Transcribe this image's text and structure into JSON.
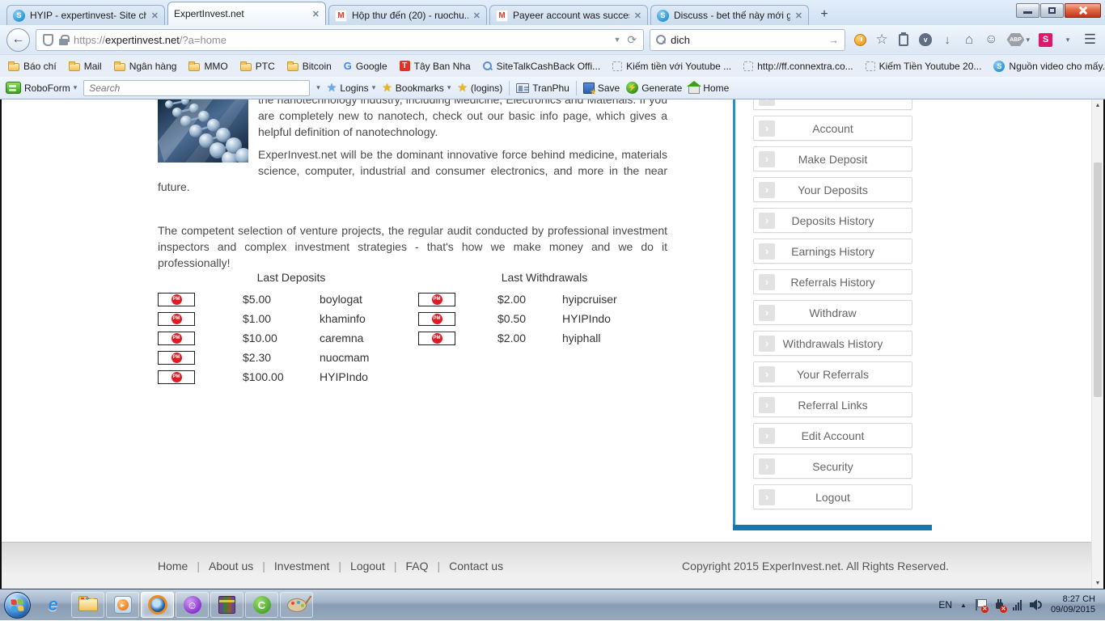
{
  "window": {
    "tabs": [
      {
        "title": "HYIP - expertinvest- Site ch...",
        "icon": "s-circle"
      },
      {
        "title": "ExpertInvest.net",
        "icon": "none"
      },
      {
        "title": "Hộp thư đến (20) - ruochu...",
        "icon": "gmail"
      },
      {
        "title": "Payeer account was succes...",
        "icon": "gmail"
      },
      {
        "title": "Discuss - bet thế này mới g...",
        "icon": "s-circle"
      }
    ]
  },
  "navbar": {
    "url_scheme": "https://",
    "url_domain": "expertinvest.net",
    "url_path": "/?a=home",
    "search_value": "dich"
  },
  "bookmarks_bar": {
    "items": [
      {
        "label": "Báo chí",
        "icon": "folder"
      },
      {
        "label": "Mail",
        "icon": "folder"
      },
      {
        "label": "Ngân hàng",
        "icon": "folder"
      },
      {
        "label": "MMO",
        "icon": "folder"
      },
      {
        "label": "PTC",
        "icon": "folder"
      },
      {
        "label": "Bitcoin",
        "icon": "folder"
      },
      {
        "label": "Google",
        "icon": "google"
      },
      {
        "label": "Tây Ban Nha",
        "icon": "red-t"
      },
      {
        "label": "SiteTalkCashBack Offi...",
        "icon": "sitetalk"
      },
      {
        "label": "Kiếm tiền với Youtube ...",
        "icon": "dashed"
      },
      {
        "label": "http://ff.connextra.co...",
        "icon": "dashed"
      },
      {
        "label": "Kiếm Tiền Youtube 20...",
        "icon": "dashed"
      },
      {
        "label": "Nguồn video cho mấy...",
        "icon": "s-circle"
      }
    ],
    "overflow": "»"
  },
  "roboform_bar": {
    "app_label": "RoboForm",
    "search_placeholder": "Search",
    "logins_label": "Logins",
    "bookmarks_label": "Bookmarks",
    "logins2_label": "(logins)",
    "identity_label": "TranPhu",
    "save_label": "Save",
    "generate_label": "Generate",
    "home_label": "Home"
  },
  "page": {
    "intro_clipped": "the nanotechnology industry, including Medicine, Electronics and Materials. If you are completely new to nanotech, check out our basic info page, which gives a helpful definition of nanotechnology.",
    "paragraph_2": "ExperInvest.net will be the dominant innovative force behind medicine, materials science, computer, industrial and consumer electronics, and more in the near future.",
    "paragraph_3": "The competent selection of venture projects, the regular audit conducted by professional investment inspectors and complex investment strategies - that's how we make money and we do it professionally!",
    "pm_label": "PM",
    "deposits": {
      "title": "Last Deposits",
      "rows": [
        {
          "amount": "$5.00",
          "user": "boylogat"
        },
        {
          "amount": "$1.00",
          "user": "khaminfo"
        },
        {
          "amount": "$10.00",
          "user": "caremna"
        },
        {
          "amount": "$2.30",
          "user": "nuocmam"
        },
        {
          "amount": "$100.00",
          "user": "HYIPIndo"
        }
      ]
    },
    "withdrawals": {
      "title": "Last Withdrawals",
      "rows": [
        {
          "amount": "$2.00",
          "user": "hyipcruiser"
        },
        {
          "amount": "$0.50",
          "user": "HYIPIndo"
        },
        {
          "amount": "$2.00",
          "user": "hyiphall"
        }
      ]
    }
  },
  "sidebar": {
    "items": [
      "Account",
      "Make Deposit",
      "Your Deposits",
      "Deposits History",
      "Earnings History",
      "Referrals History",
      "Withdraw",
      "Withdrawals History",
      "Your Referrals",
      "Referral Links",
      "Edit Account",
      "Security",
      "Logout"
    ]
  },
  "footer": {
    "links": [
      "Home",
      "About us",
      "Investment",
      "Logout",
      "FAQ",
      "Contact us"
    ],
    "separator": "|",
    "copyright": "Copyright 2015 ExperInvest.net. All Rights Reserved."
  },
  "taskbar": {
    "tray": {
      "language": "EN",
      "time": "8:27 CH",
      "date": "09/09/2015"
    }
  },
  "icons": {
    "close": "✕",
    "plus": "+",
    "back": "←",
    "caret": "▾",
    "dropmarker": "▼",
    "reload": "⟳",
    "go_arrow": "→",
    "star_outline": "☆",
    "star_solid": "★",
    "download_arrow": "↓",
    "home_glyph": "⌂",
    "smiley": "☺",
    "menu_lines": "☰",
    "overflow_chevrons": "»",
    "chevron_right": "›",
    "up_triangle": "▲",
    "s_letter": "S",
    "gmail_m": "M",
    "google_g": "G",
    "red_t": "T",
    "ie_e": "e",
    "coc_c": "C",
    "play": "►",
    "abp_label": "ABP",
    "pocket_v": "v",
    "bolt": "⚡"
  },
  "colors": {
    "accent_blue": "#2591c5",
    "sidebar_bottom_bar": "#1777ad",
    "pm_red": "#e01b24",
    "close_button_red": "#c0351c",
    "s_badge_pink": "#e0186d"
  }
}
